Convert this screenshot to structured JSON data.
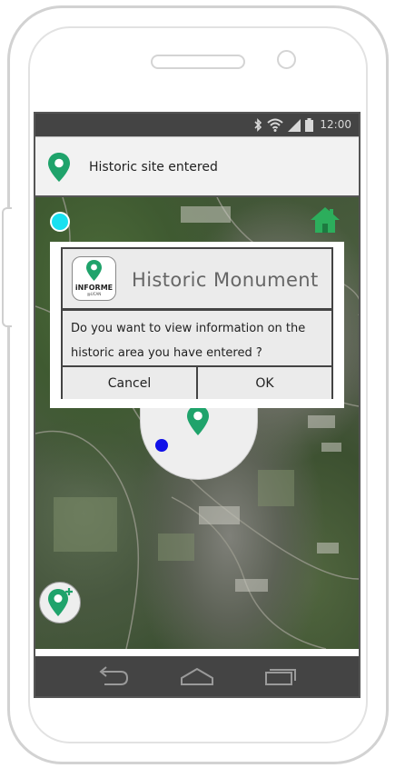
{
  "statusbar": {
    "time": "12:00",
    "icons": [
      "bluetooth-icon",
      "wifi-icon",
      "signal-icon",
      "battery-icon"
    ]
  },
  "notification": {
    "text": "Historic site entered",
    "icon": "map-pin-icon",
    "pin_color": "#1fa36b"
  },
  "dialog": {
    "title": "Historic Monument",
    "logo_text": "iNFORME",
    "logo_subtext": "@UCAN",
    "message_line1": "Do you want to view information on the",
    "message_line2": "historic area you have entered ?",
    "cancel_label": "Cancel",
    "ok_label": "OK"
  },
  "map": {
    "current_location_color": "#19e0f0",
    "user_dot_color": "#1010e8",
    "home_icon": "home-icon",
    "home_color": "#2cae5c",
    "add_pin_icon": "add-map-pin-icon"
  },
  "navbar": {
    "items": [
      "back-icon",
      "home-nav-icon",
      "recent-apps-icon"
    ]
  }
}
